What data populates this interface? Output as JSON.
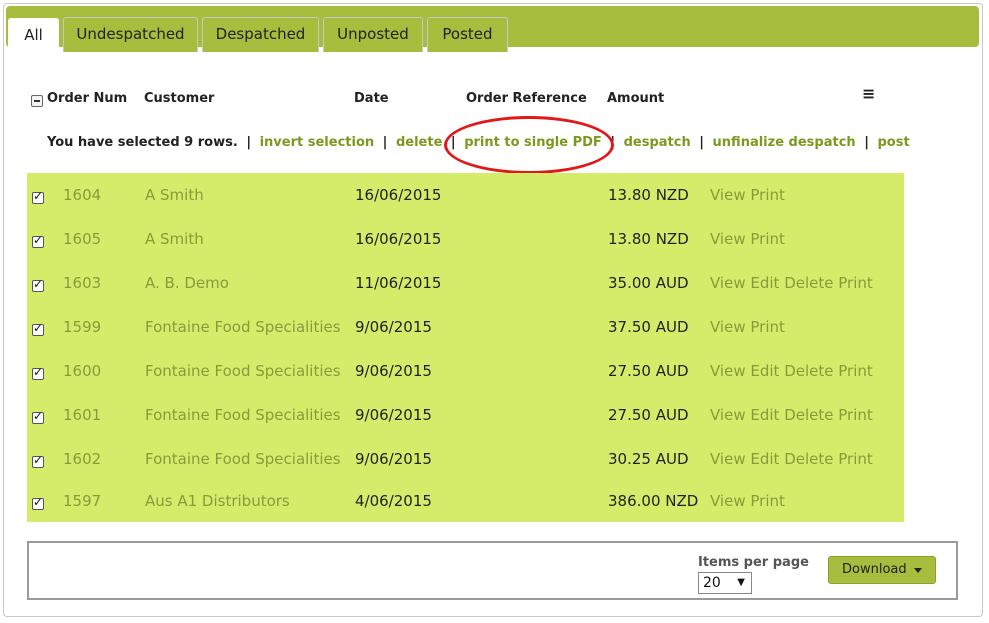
{
  "tabs": [
    "All",
    "Undespatched",
    "Despatched",
    "Unposted",
    "Posted"
  ],
  "active_tab": "All",
  "columns": {
    "order_num": "Order Num",
    "customer": "Customer",
    "date": "Date",
    "order_reference": "Order Reference",
    "amount": "Amount"
  },
  "column_menu_icon": "hamburger-menu-icon",
  "selection_bar": {
    "message": "You have selected 9 rows.",
    "invert": "invert selection",
    "delete": "delete",
    "print_pdf": "print to single PDF",
    "despatch": "despatch",
    "unfinalize": "unfinalize despatch",
    "post": "post",
    "separator": "|"
  },
  "rows": [
    {
      "num": "1604",
      "customer": "A Smith",
      "date": "16/06/2015",
      "amount": "13.80 NZD",
      "actions": [
        "View",
        "Print"
      ]
    },
    {
      "num": "1605",
      "customer": "A Smith",
      "date": "16/06/2015",
      "amount": "13.80 NZD",
      "actions": [
        "View",
        "Print"
      ]
    },
    {
      "num": "1603",
      "customer": "A. B. Demo",
      "date": "11/06/2015",
      "amount": "35.00 AUD",
      "actions": [
        "View",
        "Edit",
        "Delete",
        "Print"
      ]
    },
    {
      "num": "1599",
      "customer": "Fontaine Food Specialities",
      "date": "9/06/2015",
      "amount": "37.50 AUD",
      "actions": [
        "View",
        "Print"
      ]
    },
    {
      "num": "1600",
      "customer": "Fontaine Food Specialities",
      "date": "9/06/2015",
      "amount": "27.50 AUD",
      "actions": [
        "View",
        "Edit",
        "Delete",
        "Print"
      ]
    },
    {
      "num": "1601",
      "customer": "Fontaine Food Specialities",
      "date": "9/06/2015",
      "amount": "27.50 AUD",
      "actions": [
        "View",
        "Edit",
        "Delete",
        "Print"
      ]
    },
    {
      "num": "1602",
      "customer": "Fontaine Food Specialities",
      "date": "9/06/2015",
      "amount": "30.25 AUD",
      "actions": [
        "View",
        "Edit",
        "Delete",
        "Print"
      ]
    },
    {
      "num": "1597",
      "customer": "Aus A1 Distributors",
      "date": "4/06/2015",
      "amount": "386.00 NZD",
      "actions": [
        "View",
        "Print"
      ]
    }
  ],
  "footer": {
    "items_per_page_label": "Items per page",
    "items_per_page_value": "20",
    "download_label": "Download"
  },
  "colors": {
    "tab_bar": "#a7bd3d",
    "selected_row": "#d4ec6a",
    "link": "#7a9a1e",
    "highlight_ellipse": "#e01818"
  }
}
